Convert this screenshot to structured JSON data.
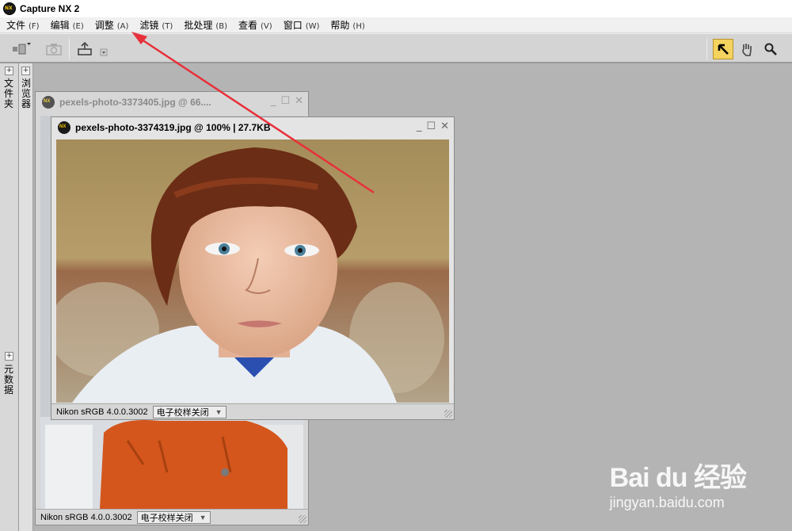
{
  "app": {
    "title": "Capture NX 2"
  },
  "menu": [
    {
      "label": "文件",
      "key": "(F)"
    },
    {
      "label": "编辑",
      "key": "(E)"
    },
    {
      "label": "调整",
      "key": "(A)"
    },
    {
      "label": "滤镜",
      "key": "(T)"
    },
    {
      "label": "批处理",
      "key": "(B)"
    },
    {
      "label": "查看",
      "key": "(V)"
    },
    {
      "label": "窗口",
      "key": "(W)"
    },
    {
      "label": "帮助",
      "key": "(H)"
    }
  ],
  "toolbar": {
    "icons": [
      "workspace-switch-icon",
      "camera-icon",
      "print-icon",
      "dropdown-small-icon",
      "selection-arrow-icon",
      "hand-icon",
      "magnifier-icon"
    ],
    "active_tool": "selection-arrow-icon"
  },
  "docks": {
    "left_panel_1": "文件夹",
    "left_panel_2": "浏览器",
    "left_panel_3": "元数据"
  },
  "window_back": {
    "title": "pexels-photo-3373405.jpg  @  66....",
    "profile": "Nikon sRGB 4.0.0.3002",
    "proof": "电子校样关闭"
  },
  "window_front": {
    "title": "pexels-photo-3374319.jpg @ 100% | 27.7KB",
    "profile": "Nikon sRGB 4.0.0.3002",
    "proof": "电子校样关闭"
  },
  "watermark": {
    "logo": "Bai du 经验",
    "url": "jingyan.baidu.com"
  },
  "colors": {
    "annotation_arrow": "#e8303a",
    "active_tool_bg": "#f4d35e",
    "workspace_bg": "#b4b4b4"
  }
}
